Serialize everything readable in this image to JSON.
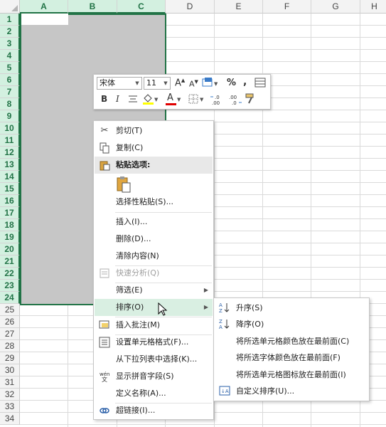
{
  "grid": {
    "columns": [
      "A",
      "B",
      "C",
      "D",
      "E",
      "F",
      "G",
      "H"
    ],
    "rows": [
      "1",
      "2",
      "3",
      "4",
      "5",
      "6",
      "7",
      "8",
      "9",
      "10",
      "11",
      "12",
      "13",
      "14",
      "15",
      "16",
      "17",
      "18",
      "19",
      "20",
      "21",
      "22",
      "23",
      "24",
      "25",
      "26",
      "27",
      "28",
      "29",
      "30",
      "31",
      "32",
      "33",
      "34"
    ],
    "selected_columns": [
      "A",
      "B",
      "C"
    ],
    "selected_rows_count": 24
  },
  "mini_toolbar": {
    "font_name": "宋体",
    "font_size": "11",
    "grow_font": "A",
    "shrink_font": "A",
    "percent": "%",
    "comma": ",",
    "bold": "B",
    "italic": "I",
    "font_color_letter": "A",
    "increase_decimal": "←.0 .00",
    "decrease_decimal": ".00 →.0"
  },
  "context_menu": {
    "items": [
      {
        "label": "剪切(T)",
        "icon": "scissors-icon"
      },
      {
        "label": "复制(C)",
        "icon": "copy-icon"
      },
      {
        "label": "粘贴选项:",
        "icon": "paste-icon"
      },
      {
        "label": "选择性粘贴(S)..."
      },
      {
        "label": "插入(I)..."
      },
      {
        "label": "删除(D)..."
      },
      {
        "label": "清除内容(N)"
      },
      {
        "label": "快速分析(Q)",
        "icon": "quick-analysis-icon"
      },
      {
        "label": "筛选(E)"
      },
      {
        "label": "排序(O)"
      },
      {
        "label": "插入批注(M)",
        "icon": "comment-icon"
      },
      {
        "label": "设置单元格格式(F)...",
        "icon": "format-cells-icon"
      },
      {
        "label": "从下拉列表中选择(K)..."
      },
      {
        "label": "显示拼音字段(S)",
        "icon": "phonetic-icon"
      },
      {
        "label": "定义名称(A)..."
      },
      {
        "label": "超链接(I)...",
        "icon": "hyperlink-icon"
      }
    ]
  },
  "sort_submenu": {
    "items": [
      {
        "label": "升序(S)"
      },
      {
        "label": "降序(O)"
      },
      {
        "label": "将所选单元格颜色放在最前面(C)"
      },
      {
        "label": "将所选字体颜色放在最前面(F)"
      },
      {
        "label": "将所选单元格图标放在最前面(I)"
      },
      {
        "label": "自定义排序(U)..."
      }
    ]
  },
  "colors": {
    "accent": "#217346",
    "selection_fill": "#c6c6c6",
    "highlight": "#d9efe2"
  }
}
